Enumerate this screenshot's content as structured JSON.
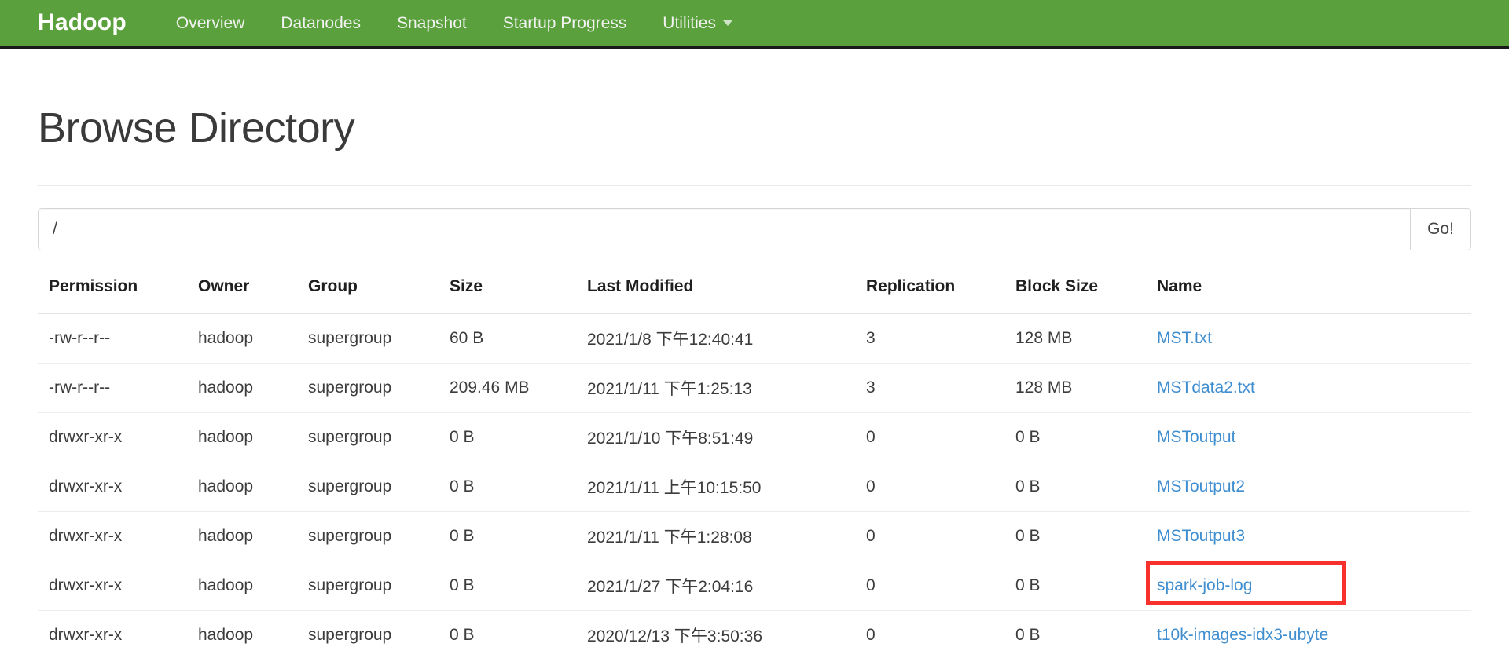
{
  "navbar": {
    "brand": "Hadoop",
    "links": [
      {
        "label": "Overview"
      },
      {
        "label": "Datanodes"
      },
      {
        "label": "Snapshot"
      },
      {
        "label": "Startup Progress"
      }
    ],
    "dropdown": {
      "label": "Utilities",
      "caret_icon": "chevron-down-icon"
    },
    "bg_color": "#5aa03c",
    "text_color": "#f2f2f2"
  },
  "page": {
    "title": "Browse Directory"
  },
  "path_bar": {
    "value": "/",
    "placeholder": "/",
    "go_label": "Go!"
  },
  "table": {
    "headers": [
      "Permission",
      "Owner",
      "Group",
      "Size",
      "Last Modified",
      "Replication",
      "Block Size",
      "Name"
    ],
    "rows": [
      {
        "permission": "-rw-r--r--",
        "owner": "hadoop",
        "group": "supergroup",
        "size": "60 B",
        "last_modified": "2021/1/8 下午12:40:41",
        "replication": "3",
        "block_size": "128 MB",
        "name": "MST.txt",
        "highlighted": false
      },
      {
        "permission": "-rw-r--r--",
        "owner": "hadoop",
        "group": "supergroup",
        "size": "209.46 MB",
        "last_modified": "2021/1/11 下午1:25:13",
        "replication": "3",
        "block_size": "128 MB",
        "name": "MSTdata2.txt",
        "highlighted": false
      },
      {
        "permission": "drwxr-xr-x",
        "owner": "hadoop",
        "group": "supergroup",
        "size": "0 B",
        "last_modified": "2021/1/10 下午8:51:49",
        "replication": "0",
        "block_size": "0 B",
        "name": "MSToutput",
        "highlighted": false
      },
      {
        "permission": "drwxr-xr-x",
        "owner": "hadoop",
        "group": "supergroup",
        "size": "0 B",
        "last_modified": "2021/1/11 上午10:15:50",
        "replication": "0",
        "block_size": "0 B",
        "name": "MSToutput2",
        "highlighted": false
      },
      {
        "permission": "drwxr-xr-x",
        "owner": "hadoop",
        "group": "supergroup",
        "size": "0 B",
        "last_modified": "2021/1/11 下午1:28:08",
        "replication": "0",
        "block_size": "0 B",
        "name": "MSToutput3",
        "highlighted": false
      },
      {
        "permission": "drwxr-xr-x",
        "owner": "hadoop",
        "group": "supergroup",
        "size": "0 B",
        "last_modified": "2021/1/27 下午2:04:16",
        "replication": "0",
        "block_size": "0 B",
        "name": "spark-job-log",
        "highlighted": true
      },
      {
        "permission": "drwxr-xr-x",
        "owner": "hadoop",
        "group": "supergroup",
        "size": "0 B",
        "last_modified": "2020/12/13 下午3:50:36",
        "replication": "0",
        "block_size": "0 B",
        "name": "t10k-images-idx3-ubyte",
        "highlighted": false
      }
    ]
  },
  "annotation": {
    "highlight_color": "#f8312d",
    "target": "spark-job-log"
  }
}
